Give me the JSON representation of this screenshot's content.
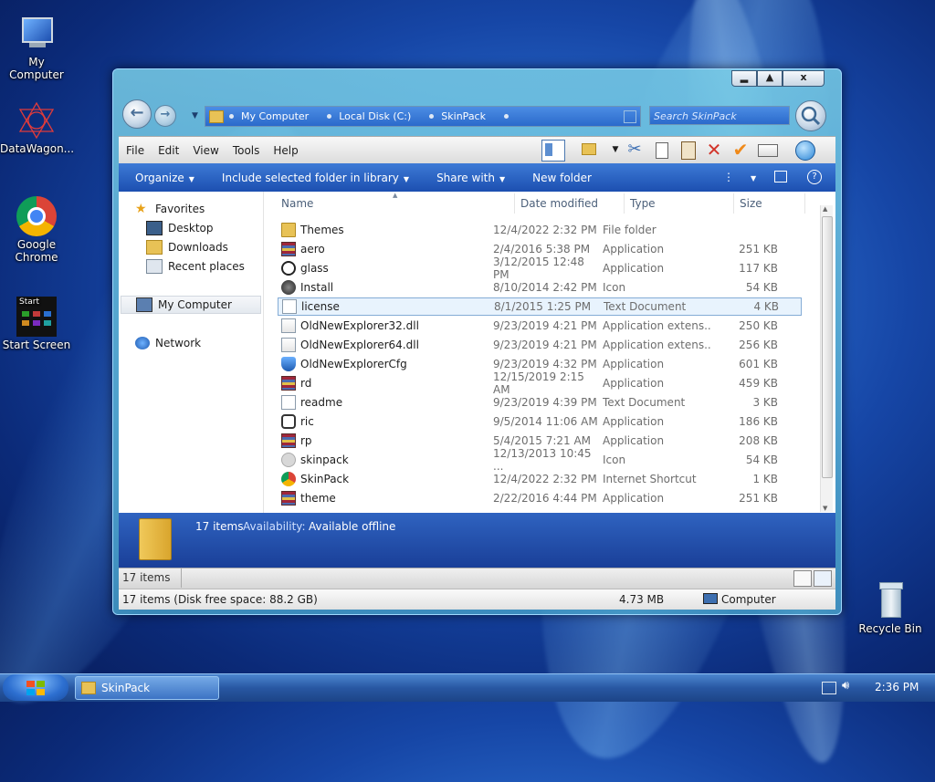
{
  "desktop": {
    "icons": [
      {
        "label": "My Computer"
      },
      {
        "label": "DataWagon..."
      },
      {
        "label": "Google\nChrome"
      },
      {
        "label": "Start Screen",
        "tile_label": "Start"
      },
      {
        "label": "Recycle Bin"
      }
    ]
  },
  "window": {
    "caption_buttons": {
      "minimize": "▂",
      "maximize": "▲",
      "close": "x"
    },
    "address_crumbs": [
      "My Computer",
      "Local Disk (C:)",
      "SkinPack"
    ],
    "search_placeholder": "Search SkinPack",
    "menu": [
      "File",
      "Edit",
      "View",
      "Tools",
      "Help"
    ],
    "command_bar": {
      "organize": "Organize",
      "include": "Include selected folder in library",
      "share": "Share with",
      "new_folder": "New folder"
    },
    "nav_pane": {
      "favorites": "Favorites",
      "desktop": "Desktop",
      "downloads": "Downloads",
      "recent": "Recent places",
      "my_computer": "My Computer",
      "network": "Network"
    },
    "columns": {
      "name": "Name",
      "date": "Date modified",
      "type": "Type",
      "size": "Size"
    },
    "files": [
      {
        "name": "Themes",
        "date": "12/4/2022 2:32 PM",
        "type": "File folder",
        "size": "",
        "icon": "folder-icon"
      },
      {
        "name": "aero",
        "date": "2/4/2016 5:38 PM",
        "type": "Application",
        "size": "251 KB",
        "icon": "archive-app-icon"
      },
      {
        "name": "glass",
        "date": "3/12/2015 12:48 PM",
        "type": "Application",
        "size": "117 KB",
        "icon": "sp-app-icon"
      },
      {
        "name": "Install",
        "date": "8/10/2014 2:42 PM",
        "type": "Icon",
        "size": "54 KB",
        "icon": "install-icon"
      },
      {
        "name": "license",
        "date": "8/1/2015 1:25 PM",
        "type": "Text Document",
        "size": "4 KB",
        "icon": "text-document-icon",
        "selected": true
      },
      {
        "name": "OldNewExplorer32.dll",
        "date": "9/23/2019 4:21 PM",
        "type": "Application extens...",
        "size": "250 KB",
        "icon": "dll-icon"
      },
      {
        "name": "OldNewExplorer64.dll",
        "date": "9/23/2019 4:21 PM",
        "type": "Application extens...",
        "size": "256 KB",
        "icon": "dll-icon"
      },
      {
        "name": "OldNewExplorerCfg",
        "date": "9/23/2019 4:32 PM",
        "type": "Application",
        "size": "601 KB",
        "icon": "shield-app-icon"
      },
      {
        "name": "rd",
        "date": "12/15/2019 2:15 AM",
        "type": "Application",
        "size": "459 KB",
        "icon": "archive-app-icon"
      },
      {
        "name": "readme",
        "date": "9/23/2019 4:39 PM",
        "type": "Text Document",
        "size": "3 KB",
        "icon": "text-document-icon"
      },
      {
        "name": "ric",
        "date": "9/5/2014 11:06 AM",
        "type": "Application",
        "size": "186 KB",
        "icon": "ric-app-icon"
      },
      {
        "name": "rp",
        "date": "5/4/2015 7:21 AM",
        "type": "Application",
        "size": "208 KB",
        "icon": "archive-app-icon"
      },
      {
        "name": "skinpack",
        "date": "12/13/2013 10:45 ...",
        "type": "Icon",
        "size": "54 KB",
        "icon": "sp-grey-icon"
      },
      {
        "name": "SkinPack",
        "date": "12/4/2022 2:32 PM",
        "type": "Internet Shortcut",
        "size": "1 KB",
        "icon": "chrome-shortcut-icon"
      },
      {
        "name": "theme",
        "date": "2/22/2016 4:44 PM",
        "type": "Application",
        "size": "251 KB",
        "icon": "archive-app-icon"
      }
    ],
    "details_pane": {
      "count": "17 items",
      "availability_label": "Availability:",
      "availability_value": "Available offline"
    },
    "status_band": {
      "count": "17 items"
    },
    "status_bar": {
      "left": "17 items (Disk free space: 88.2 GB)",
      "size": "4.73 MB",
      "location": "Computer"
    }
  },
  "taskbar": {
    "item": "SkinPack",
    "clock": "2:36 PM"
  },
  "colors": {
    "accent": "#2b6acb",
    "selection": "#e8f3fd"
  }
}
